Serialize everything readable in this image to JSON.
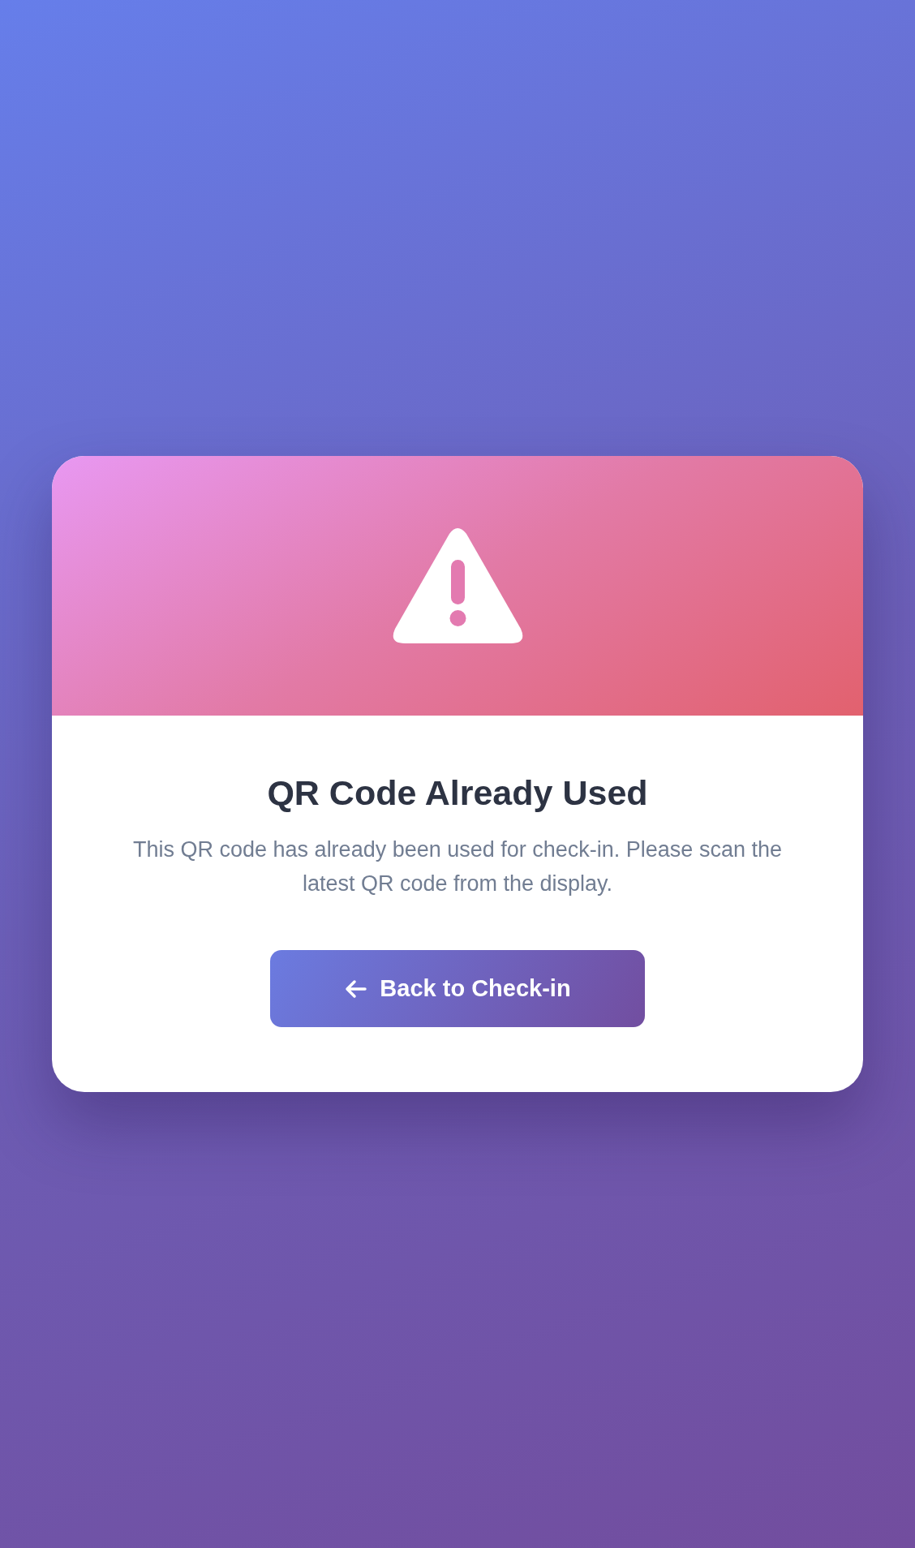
{
  "title": "QR Code Already Used",
  "message": "This QR code has already been used for check-in. Please scan the latest QR code from the display.",
  "button": {
    "label": "Back to Check-in"
  }
}
